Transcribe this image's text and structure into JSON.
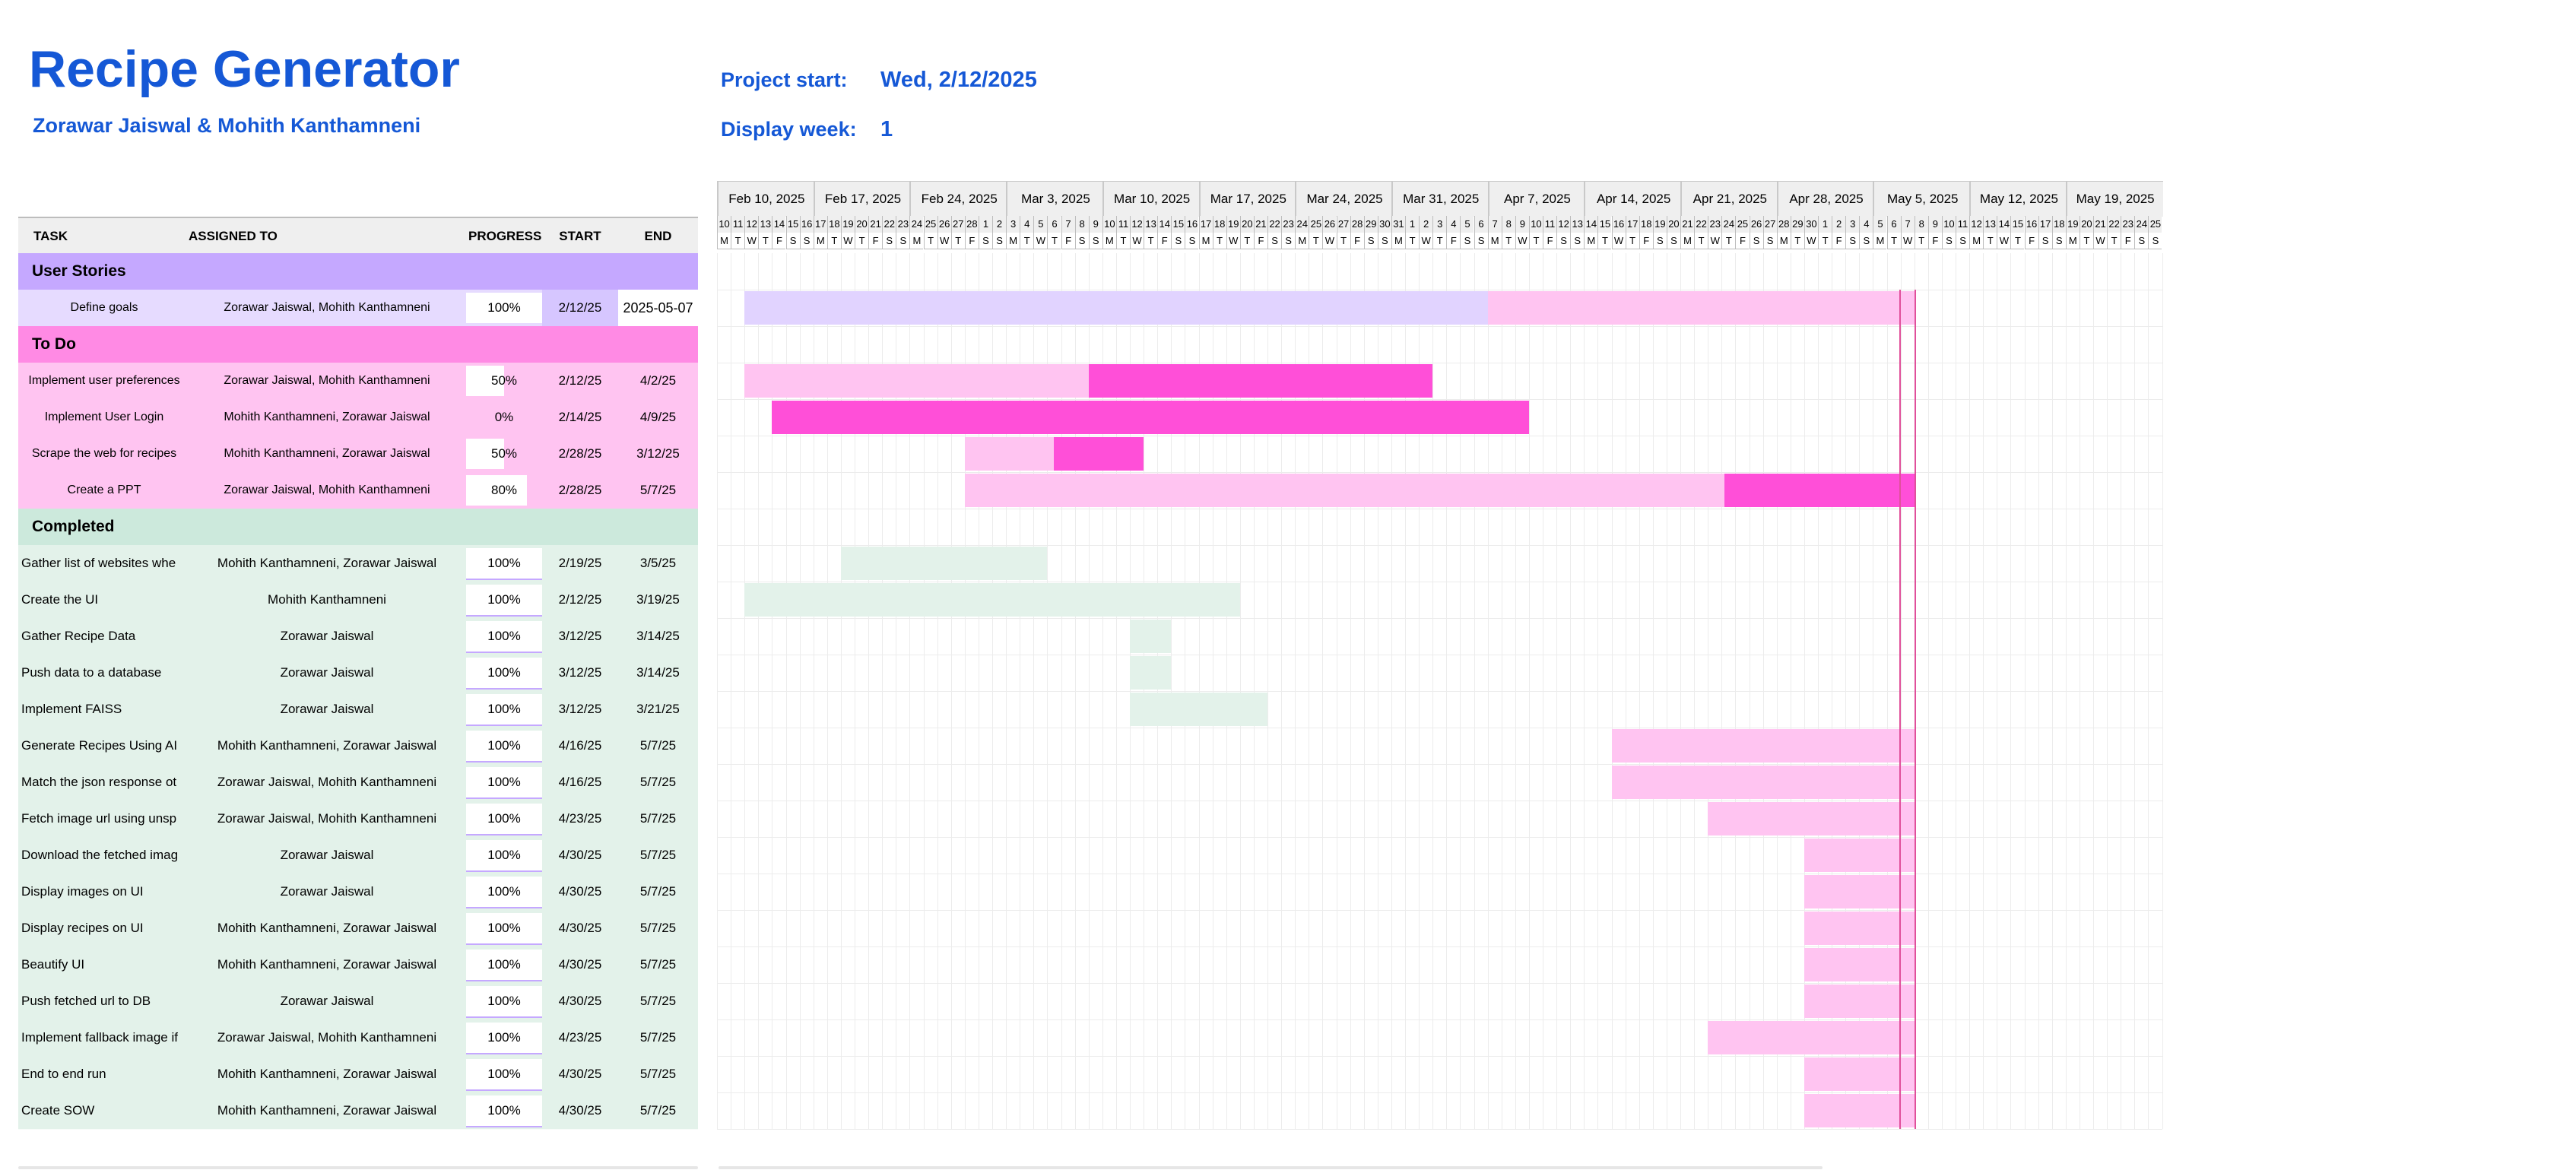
{
  "header": {
    "title": "Recipe Generator",
    "team": "Zorawar Jaiswal & Mohith Kanthamneni",
    "project_start_label": "Project start:",
    "project_start_value": "Wed, 2/12/2025",
    "display_week_label": "Display week:",
    "display_week_value": "1"
  },
  "table": {
    "columns": [
      "TASK",
      "ASSIGNED TO",
      "PROGRESS",
      "START",
      "END"
    ],
    "groups": [
      {
        "name": "User Stories",
        "colors": {
          "header": "#c5a8ff",
          "row": "#e6dbff"
        },
        "tasks": [
          {
            "task": "Define goals",
            "assigned": "Zorawar Jaiswal, Mohith Kanthamneni",
            "progress": "100%",
            "progress_value": 1.0,
            "start": "2/12/25",
            "end": "2025-05-07"
          }
        ]
      },
      {
        "name": "To Do",
        "colors": {
          "header": "#ff8ae4",
          "row": "#ffc4f1"
        },
        "tasks": [
          {
            "task": "Implement user preferences",
            "assigned": "Zorawar Jaiswal, Mohith Kanthamneni",
            "progress": "50%",
            "progress_value": 0.5,
            "start": "2/12/25",
            "end": "4/2/25"
          },
          {
            "task": "Implement User Login",
            "assigned": "Mohith Kanthamneni, Zorawar Jaiswal",
            "progress": "0%",
            "progress_value": 0.0,
            "start": "2/14/25",
            "end": "4/9/25"
          },
          {
            "task": "Scrape the web for recipes",
            "assigned": "Mohith Kanthamneni, Zorawar Jaiswal",
            "progress": "50%",
            "progress_value": 0.5,
            "start": "2/28/25",
            "end": "3/12/25"
          },
          {
            "task": "Create a PPT",
            "assigned": "Zorawar Jaiswal, Mohith Kanthamneni",
            "progress": "80%",
            "progress_value": 0.8,
            "start": "2/28/25",
            "end": "5/7/25"
          }
        ]
      },
      {
        "name": "Completed",
        "colors": {
          "header": "#cce9dc",
          "row": "#e3f2ea"
        },
        "tasks": [
          {
            "task": "Gather list of websites whe",
            "assigned": "Mohith Kanthamneni, Zorawar Jaiswal",
            "progress": "100%",
            "progress_value": 1.0,
            "start": "2/19/25",
            "end": "3/5/25"
          },
          {
            "task": "Create the UI",
            "assigned": "Mohith Kanthamneni",
            "progress": "100%",
            "progress_value": 1.0,
            "start": "2/12/25",
            "end": "3/19/25"
          },
          {
            "task": "Gather Recipe Data",
            "assigned": "Zorawar Jaiswal",
            "progress": "100%",
            "progress_value": 1.0,
            "start": "3/12/25",
            "end": "3/14/25"
          },
          {
            "task": "Push data to a database",
            "assigned": "Zorawar Jaiswal",
            "progress": "100%",
            "progress_value": 1.0,
            "start": "3/12/25",
            "end": "3/14/25"
          },
          {
            "task": "Implement FAISS",
            "assigned": "Zorawar Jaiswal",
            "progress": "100%",
            "progress_value": 1.0,
            "start": "3/12/25",
            "end": "3/21/25"
          },
          {
            "task": "Generate Recipes Using AI",
            "assigned": "Mohith Kanthamneni, Zorawar Jaiswal",
            "progress": "100%",
            "progress_value": 1.0,
            "start": "4/16/25",
            "end": "5/7/25"
          },
          {
            "task": "Match the json response ot",
            "assigned": "Zorawar Jaiswal, Mohith Kanthamneni",
            "progress": "100%",
            "progress_value": 1.0,
            "start": "4/16/25",
            "end": "5/7/25"
          },
          {
            "task": "Fetch image url using unsp",
            "assigned": "Zorawar Jaiswal, Mohith Kanthamneni",
            "progress": "100%",
            "progress_value": 1.0,
            "start": "4/23/25",
            "end": "5/7/25"
          },
          {
            "task": "Download the fetched imag",
            "assigned": "Zorawar Jaiswal",
            "progress": "100%",
            "progress_value": 1.0,
            "start": "4/30/25",
            "end": "5/7/25"
          },
          {
            "task": "Display images on UI",
            "assigned": "Zorawar Jaiswal",
            "progress": "100%",
            "progress_value": 1.0,
            "start": "4/30/25",
            "end": "5/7/25"
          },
          {
            "task": "Display recipes on UI",
            "assigned": "Mohith Kanthamneni, Zorawar Jaiswal",
            "progress": "100%",
            "progress_value": 1.0,
            "start": "4/30/25",
            "end": "5/7/25"
          },
          {
            "task": "Beautify UI",
            "assigned": "Mohith Kanthamneni, Zorawar Jaiswal",
            "progress": "100%",
            "progress_value": 1.0,
            "start": "4/30/25",
            "end": "5/7/25"
          },
          {
            "task": "Push fetched url to DB",
            "assigned": "Zorawar Jaiswal",
            "progress": "100%",
            "progress_value": 1.0,
            "start": "4/30/25",
            "end": "5/7/25"
          },
          {
            "task": "Implement fallback image if",
            "assigned": "Zorawar Jaiswal, Mohith Kanthamneni",
            "progress": "100%",
            "progress_value": 1.0,
            "start": "4/23/25",
            "end": "5/7/25"
          },
          {
            "task": "End to end run",
            "assigned": "Mohith Kanthamneni, Zorawar Jaiswal",
            "progress": "100%",
            "progress_value": 1.0,
            "start": "4/30/25",
            "end": "5/7/25"
          },
          {
            "task": "Create SOW",
            "assigned": "Mohith Kanthamneni, Zorawar Jaiswal",
            "progress": "100%",
            "progress_value": 1.0,
            "start": "4/30/25",
            "end": "5/7/25"
          }
        ]
      }
    ]
  },
  "timeline": {
    "weeks": [
      "Feb 10, 2025",
      "Feb 17, 2025",
      "Feb 24, 2025",
      "Mar 3, 2025",
      "Mar 10, 2025",
      "Mar 17, 2025",
      "Mar 24, 2025",
      "Mar 31, 2025",
      "Apr 7, 2025",
      "Apr 14, 2025",
      "Apr 21, 2025",
      "Apr 28, 2025",
      "May 5, 2025",
      "May 12, 2025",
      "May 19, 2025"
    ],
    "day_letters": [
      "M",
      "T",
      "W",
      "T",
      "F",
      "S",
      "S"
    ],
    "first_day": "2025-02-10",
    "today": "2025-05-07",
    "bar_colors": {
      "User Stories": {
        "light": "#e1d3ff",
        "dark": "#ffc4f1"
      },
      "To Do": {
        "light": "#ffc4f1",
        "dark": "#ff4fd8"
      },
      "Completed": {
        "light": "#e3f2ea",
        "dark": "#e3f2ea"
      }
    },
    "today_color": "#e0509b"
  }
}
